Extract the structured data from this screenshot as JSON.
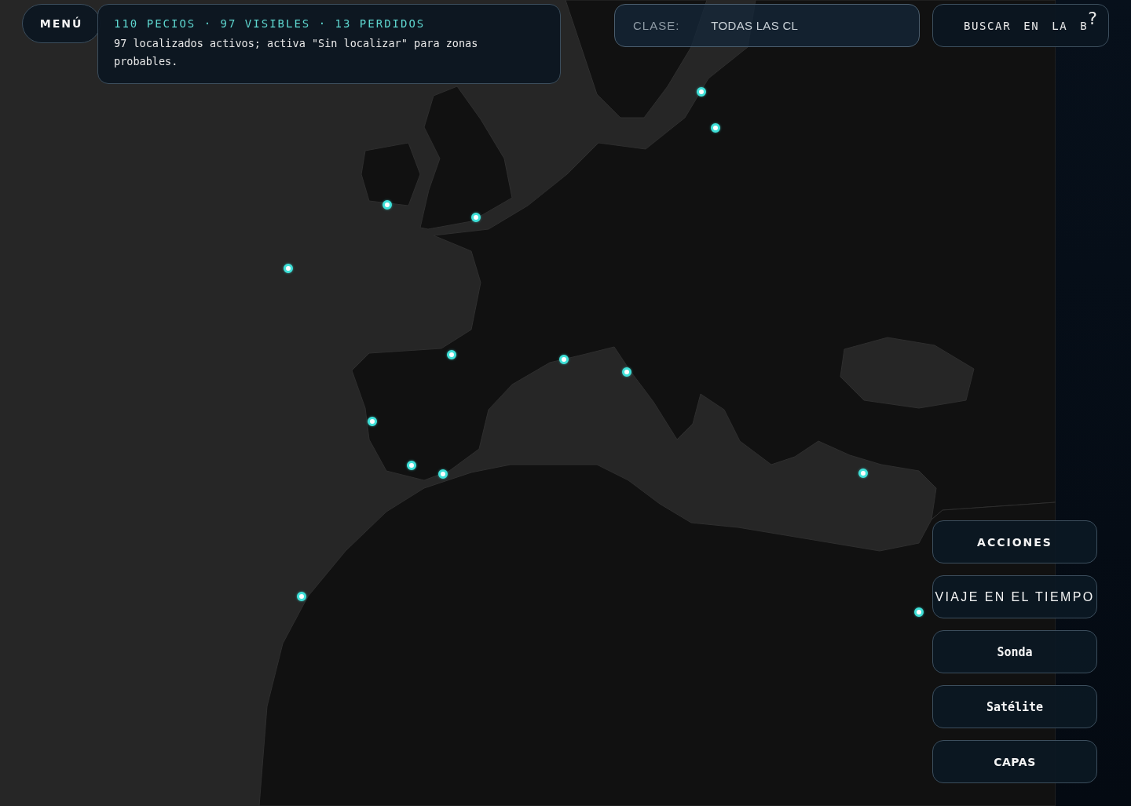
{
  "menu_button": {
    "label": "MENÚ"
  },
  "summary": {
    "title": "110 PECIOS · 97 VISIBLES · 13 PERDIDOS",
    "message": "97 localizados activos; activa \"Sin localizar\" para zonas probables."
  },
  "class_filter": {
    "label": "CLASE:",
    "value": "TODAS LAS CL"
  },
  "search": {
    "placeholder": "BUSCAR EN LA B",
    "help": "?"
  },
  "action_buttons": [
    {
      "label": "ACCIONES",
      "kind": "actions"
    },
    {
      "label": "VIAJE EN EL TIEMPO",
      "kind": "time"
    },
    {
      "label": "Sonda",
      "kind": "toggle"
    },
    {
      "label": "Satélite",
      "kind": "toggle"
    },
    {
      "label": "CAPAS",
      "kind": "layers"
    }
  ]
}
